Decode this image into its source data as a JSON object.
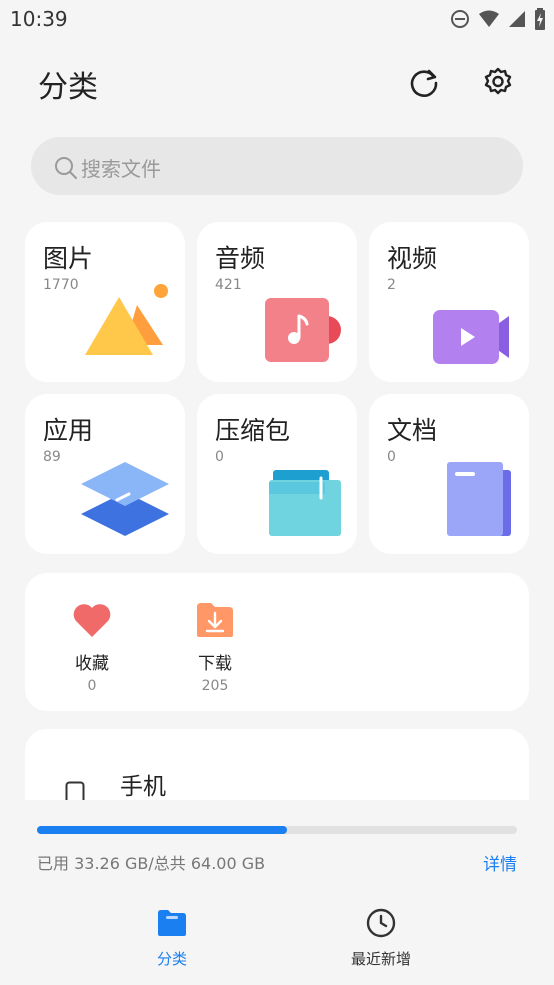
{
  "status": {
    "time": "10:39"
  },
  "header": {
    "title": "分类"
  },
  "search": {
    "placeholder": "搜索文件"
  },
  "categories": [
    {
      "label": "图片",
      "count": "1770"
    },
    {
      "label": "音频",
      "count": "421"
    },
    {
      "label": "视频",
      "count": "2"
    },
    {
      "label": "应用",
      "count": "89"
    },
    {
      "label": "压缩包",
      "count": "0"
    },
    {
      "label": "文档",
      "count": "0"
    }
  ],
  "quick": [
    {
      "label": "收藏",
      "count": "0"
    },
    {
      "label": "下载",
      "count": "205"
    }
  ],
  "storage": {
    "device": "手机",
    "usage_text": "已用 33.26 GB/总共 64.00 GB",
    "used_fraction": 0.52,
    "details_label": "详情"
  },
  "nav": [
    {
      "label": "分类",
      "active": true
    },
    {
      "label": "最近新增",
      "active": false
    }
  ],
  "colors": {
    "accent": "#1a7ff0",
    "heart": "#f06a6a",
    "download": "#ff9866"
  }
}
